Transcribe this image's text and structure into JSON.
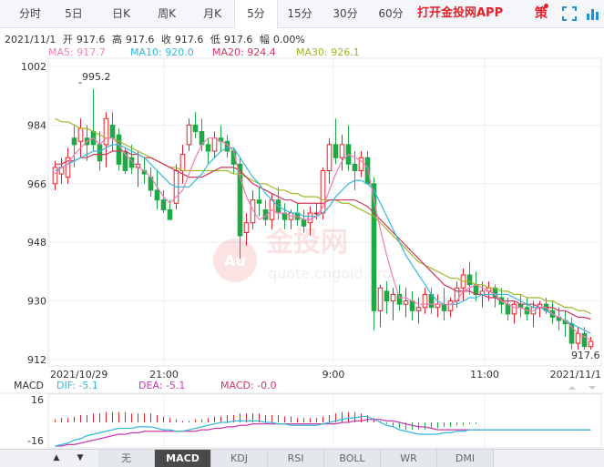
{
  "toolbar": {
    "tabs": [
      "分时",
      "5日",
      "日K",
      "周K",
      "月K",
      "5分",
      "15分",
      "30分",
      "60分"
    ],
    "active_tab": "5分",
    "promo": "打开金投网APP",
    "ce_label": "策"
  },
  "quote": {
    "date": "2021/11/1",
    "open_label": "开",
    "open": "917.6",
    "high_label": "高",
    "high": "917.6",
    "close_label": "收",
    "close": "917.6",
    "low_label": "低",
    "low": "917.6",
    "change_label": "幅",
    "change": "0.00%"
  },
  "ma": {
    "ma5": "MA5: 917.7",
    "ma10": "MA10: 920.0",
    "ma20": "MA20: 924.4",
    "ma30": "MA30: 926.1"
  },
  "colors": {
    "up": "#e4212a",
    "down": "#1fa845",
    "ma5": "#f27cb4",
    "ma10": "#35b8da",
    "ma20": "#d1365c",
    "ma30": "#a0b826",
    "dif": "#35b8da",
    "dea": "#c93ab2"
  },
  "chart_data": {
    "type": "candlestick",
    "y_ticks": [
      "1002",
      "984",
      "966",
      "948",
      "930",
      "912"
    ],
    "ylim": [
      912,
      1002
    ],
    "x_ticks": [
      "2021/10/29",
      "21:00",
      "9:00",
      "11:00",
      "2021/11/1"
    ],
    "annotations": {
      "max": "995.2",
      "last": "917.6"
    },
    "watermark": {
      "brand": "金投网",
      "url": "quote.cngold.org",
      "logo": "Au"
    },
    "candles": [
      [
        966,
        973,
        964,
        971
      ],
      [
        969,
        974,
        966,
        971
      ],
      [
        968,
        977,
        966,
        974
      ],
      [
        980,
        984,
        971,
        978
      ],
      [
        979,
        986,
        974,
        983
      ],
      [
        980,
        984,
        973,
        978
      ],
      [
        982,
        995.2,
        976,
        978
      ],
      [
        978,
        982,
        970,
        973
      ],
      [
        978,
        988,
        971,
        986
      ],
      [
        984,
        988,
        976,
        980
      ],
      [
        981,
        983,
        970,
        972
      ],
      [
        976,
        977,
        969,
        970
      ],
      [
        974,
        978,
        969,
        971
      ],
      [
        971,
        976,
        965,
        972
      ],
      [
        970,
        974,
        966,
        969
      ],
      [
        968,
        971,
        962,
        964
      ],
      [
        964,
        970,
        958,
        961
      ],
      [
        961,
        964,
        957,
        958
      ],
      [
        958,
        961,
        955,
        955
      ],
      [
        960,
        972,
        958,
        970
      ],
      [
        970,
        978,
        966,
        975
      ],
      [
        978,
        986,
        976,
        984
      ],
      [
        984,
        988,
        980,
        982
      ],
      [
        982,
        986,
        976,
        978
      ],
      [
        978,
        980,
        972,
        976
      ],
      [
        976,
        982,
        974,
        980
      ],
      [
        980,
        984,
        976,
        979
      ],
      [
        979,
        981,
        974,
        976
      ],
      [
        976,
        977,
        969,
        972
      ],
      [
        972,
        974,
        943,
        950
      ],
      [
        951,
        957,
        947,
        954
      ],
      [
        954,
        964,
        952,
        961
      ],
      [
        961,
        965,
        956,
        960
      ],
      [
        958,
        961,
        953,
        955
      ],
      [
        955,
        963,
        952,
        961
      ],
      [
        961,
        965,
        955,
        957
      ],
      [
        957,
        960,
        952,
        955
      ],
      [
        955,
        958,
        952,
        957
      ],
      [
        957,
        960,
        953,
        955
      ],
      [
        955,
        958,
        951,
        953
      ],
      [
        954,
        959,
        950,
        957
      ],
      [
        957,
        960,
        955,
        957
      ],
      [
        957,
        971,
        955,
        970
      ],
      [
        970,
        980,
        966,
        978
      ],
      [
        978,
        986,
        972,
        974
      ],
      [
        974,
        981,
        970,
        978
      ],
      [
        978,
        984,
        970,
        972
      ],
      [
        972,
        976,
        964,
        970
      ],
      [
        970,
        976,
        968,
        974
      ],
      [
        974,
        976,
        966,
        966
      ],
      [
        966,
        968,
        921,
        927
      ],
      [
        927,
        935,
        922,
        934
      ],
      [
        933,
        936,
        926,
        930
      ],
      [
        930,
        934,
        924,
        932
      ],
      [
        932,
        935,
        927,
        929
      ],
      [
        929,
        934,
        925,
        930
      ],
      [
        930,
        933,
        924,
        927
      ],
      [
        927,
        931,
        923,
        928
      ],
      [
        928,
        934,
        926,
        932
      ],
      [
        932,
        934,
        926,
        928
      ],
      [
        928,
        932,
        925,
        929
      ],
      [
        929,
        934,
        924,
        927
      ],
      [
        927,
        931,
        925,
        930
      ],
      [
        930,
        936,
        928,
        934
      ],
      [
        934,
        940,
        930,
        938
      ],
      [
        938,
        942,
        932,
        935
      ],
      [
        935,
        939,
        930,
        932
      ],
      [
        932,
        936,
        928,
        933
      ],
      [
        933,
        936,
        930,
        934
      ],
      [
        934,
        935,
        928,
        931
      ],
      [
        931,
        934,
        926,
        929
      ],
      [
        929,
        931,
        924,
        926
      ],
      [
        926,
        930,
        923,
        929
      ],
      [
        929,
        932,
        925,
        928
      ],
      [
        928,
        931,
        924,
        926
      ],
      [
        926,
        930,
        922,
        928
      ],
      [
        928,
        930,
        925,
        929
      ],
      [
        929,
        931,
        926,
        927
      ],
      [
        927,
        930,
        923,
        925
      ],
      [
        925,
        928,
        921,
        924
      ],
      [
        924,
        927,
        919,
        923
      ],
      [
        923,
        925,
        915,
        917
      ],
      [
        917,
        922,
        915,
        920
      ],
      [
        920,
        922,
        915,
        916
      ],
      [
        916,
        919,
        915,
        917.6
      ]
    ],
    "ma5": [
      969,
      971,
      972,
      975,
      977,
      979,
      980,
      978,
      980,
      980,
      978,
      975,
      973,
      971,
      970,
      968,
      965,
      962,
      960,
      962,
      964,
      969,
      974,
      978,
      980,
      980,
      979,
      978,
      976,
      968,
      962,
      958,
      955,
      956,
      958,
      957,
      957,
      956,
      956,
      955,
      955,
      956,
      959,
      964,
      969,
      973,
      975,
      974,
      973,
      971,
      961,
      952,
      944,
      937,
      931,
      931,
      930,
      929,
      929,
      929,
      929,
      929,
      929,
      930,
      933,
      934,
      935,
      934,
      933,
      932,
      930,
      929,
      928,
      928,
      927,
      927,
      928,
      928,
      926,
      925,
      924,
      922,
      920,
      919,
      918
    ],
    "ma10": [
      970,
      971,
      972,
      973,
      974,
      975,
      976,
      976,
      977,
      978,
      978,
      977,
      976,
      975,
      974,
      972,
      970,
      968,
      966,
      965,
      965,
      965,
      967,
      969,
      972,
      974,
      976,
      977,
      977,
      974,
      971,
      968,
      966,
      963,
      961,
      959,
      958,
      957,
      957,
      956,
      956,
      956,
      957,
      959,
      962,
      964,
      966,
      967,
      967,
      966,
      964,
      960,
      956,
      952,
      948,
      944,
      941,
      938,
      935,
      932,
      930,
      929,
      929,
      929,
      930,
      931,
      931,
      932,
      932,
      932,
      932,
      932,
      931,
      930,
      929,
      928,
      928,
      927,
      926,
      925,
      924,
      923,
      922,
      921,
      920
    ],
    "ma20": [
      972,
      972,
      973,
      973,
      974,
      974,
      975,
      975,
      975,
      976,
      976,
      976,
      975,
      975,
      974,
      974,
      973,
      972,
      971,
      970,
      969,
      968,
      968,
      968,
      969,
      970,
      971,
      971,
      971,
      970,
      968,
      966,
      965,
      964,
      963,
      962,
      961,
      961,
      960,
      960,
      960,
      960,
      960,
      961,
      961,
      961,
      961,
      961,
      960,
      959,
      957,
      955,
      953,
      951,
      949,
      947,
      945,
      943,
      941,
      939,
      937,
      935,
      934,
      933,
      933,
      933,
      932,
      932,
      931,
      931,
      930,
      930,
      930,
      929,
      929,
      929,
      928,
      928,
      928,
      927,
      927,
      926,
      925,
      925,
      924.4
    ],
    "ma30": [
      986,
      985,
      985,
      984,
      983,
      983,
      982,
      981,
      980,
      980,
      979,
      978,
      977,
      976,
      975,
      974,
      973,
      972,
      971,
      971,
      970,
      970,
      970,
      970,
      970,
      970,
      970,
      970,
      969,
      969,
      968,
      967,
      966,
      966,
      965,
      964,
      964,
      963,
      963,
      962,
      962,
      962,
      961,
      961,
      961,
      960,
      960,
      959,
      958,
      957,
      956,
      954,
      952,
      950,
      948,
      946,
      944,
      942,
      941,
      940,
      939,
      938,
      937,
      937,
      936,
      936,
      935,
      935,
      934,
      934,
      933,
      933,
      932,
      932,
      931,
      931,
      931,
      930,
      930,
      929,
      928,
      928,
      927,
      927,
      926.1
    ],
    "macd": {
      "y_ticks": [
        "16",
        "-16"
      ],
      "labels": {
        "title": "MACD",
        "dif": "DIF: -5.1",
        "dea": "DEA: -5.1",
        "macd": "MACD: -0.0"
      },
      "hist": [
        2,
        3,
        3,
        4,
        5,
        5,
        6,
        6,
        7,
        7,
        7,
        7,
        6,
        6,
        6,
        6,
        5,
        4,
        3,
        2,
        1,
        1,
        2,
        2,
        3,
        4,
        4,
        5,
        5,
        6,
        6,
        6,
        6,
        5,
        5,
        5,
        4,
        4,
        3,
        3,
        3,
        3,
        4,
        5,
        6,
        7,
        7,
        7,
        6,
        5,
        3,
        1,
        -1,
        -3,
        -4,
        -5,
        -5,
        -5,
        -5,
        -4,
        -4,
        -3,
        -3,
        -2,
        -2,
        -1,
        -1,
        0,
        0,
        0,
        0,
        0,
        0,
        0,
        0,
        0,
        0,
        0,
        0,
        0,
        0,
        0,
        0,
        0,
        0
      ],
      "dif": [
        -16,
        -15,
        -14,
        -12,
        -11,
        -9,
        -8,
        -7,
        -6,
        -5,
        -4,
        -4,
        -4,
        -3,
        -3,
        -3,
        -4,
        -5,
        -5,
        -6,
        -6,
        -5,
        -4,
        -3,
        -2,
        -1,
        0,
        0,
        1,
        1,
        1,
        1,
        1,
        0,
        0,
        -1,
        -1,
        -2,
        -2,
        -2,
        -2,
        -2,
        -1,
        0,
        1,
        2,
        3,
        3,
        4,
        4,
        2,
        0,
        -2,
        -3,
        -5,
        -6,
        -7,
        -8,
        -8,
        -8,
        -8,
        -7,
        -7,
        -6,
        -6,
        -5,
        -5,
        -5,
        -5,
        -5,
        -5,
        -5,
        -5,
        -5,
        -5,
        -5,
        -5,
        -5,
        -5,
        -5,
        -5,
        -5,
        -5,
        -5,
        -5.1
      ],
      "dea": [
        -16,
        -16,
        -15,
        -15,
        -14,
        -13,
        -12,
        -11,
        -10,
        -9,
        -8,
        -8,
        -7,
        -7,
        -6,
        -6,
        -6,
        -6,
        -6,
        -6,
        -6,
        -6,
        -6,
        -5,
        -5,
        -4,
        -4,
        -3,
        -3,
        -2,
        -2,
        -1,
        -1,
        -1,
        -1,
        -1,
        -1,
        -1,
        -1,
        -1,
        -1,
        -1,
        -1,
        -1,
        -1,
        0,
        0,
        1,
        1,
        2,
        2,
        2,
        1,
        1,
        0,
        -1,
        -2,
        -3,
        -3,
        -4,
        -5,
        -5,
        -5,
        -5,
        -5,
        -5,
        -5,
        -5,
        -5,
        -5,
        -5,
        -5,
        -5,
        -5,
        -5,
        -5,
        -5,
        -5,
        -5,
        -5,
        -5,
        -5,
        -5,
        -5,
        -5.1
      ]
    }
  },
  "bottom": {
    "nav": [
      "▲",
      "▼"
    ],
    "tabs": [
      "无",
      "MACD",
      "KDJ",
      "RSI",
      "BOLL",
      "WR",
      "DMI"
    ],
    "active": "MACD"
  }
}
